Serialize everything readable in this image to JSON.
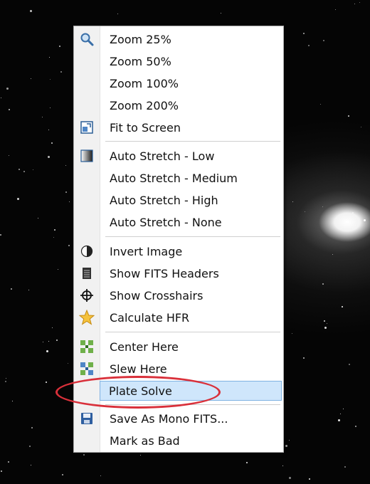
{
  "menu": {
    "items": [
      {
        "label": "Zoom 25%",
        "icon": "magnifier-icon"
      },
      {
        "label": "Zoom 50%",
        "icon": ""
      },
      {
        "label": "Zoom 100%",
        "icon": ""
      },
      {
        "label": "Zoom 200%",
        "icon": ""
      },
      {
        "label": "Fit to Screen",
        "icon": "fit-screen-icon"
      },
      {
        "label": "Auto Stretch - Low",
        "icon": "gradient-icon"
      },
      {
        "label": "Auto Stretch - Medium",
        "icon": ""
      },
      {
        "label": "Auto Stretch - High",
        "icon": ""
      },
      {
        "label": "Auto Stretch - None",
        "icon": ""
      },
      {
        "label": "Invert Image",
        "icon": "half-circle-icon"
      },
      {
        "label": "Show FITS Headers",
        "icon": "document-stack-icon"
      },
      {
        "label": "Show Crosshairs",
        "icon": "crosshair-icon"
      },
      {
        "label": "Calculate HFR",
        "icon": "star-icon"
      },
      {
        "label": "Center Here",
        "icon": "center-arrows-icon"
      },
      {
        "label": "Slew Here",
        "icon": "slew-arrows-icon"
      },
      {
        "label": "Plate Solve",
        "icon": "",
        "highlighted": true
      },
      {
        "label": "Save As Mono FITS...",
        "icon": "floppy-disk-icon"
      },
      {
        "label": "Mark as Bad",
        "icon": ""
      }
    ]
  },
  "colors": {
    "highlight_bg": "#cfe6fb",
    "highlight_border": "#7fb2e2",
    "annotation_circle": "#d9303a"
  }
}
